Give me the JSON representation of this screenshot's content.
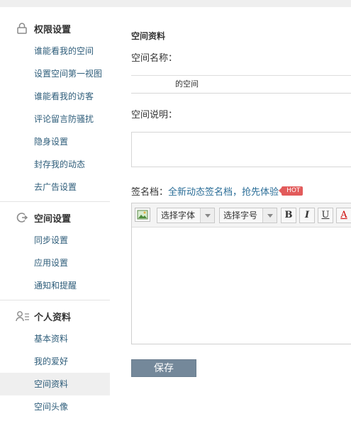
{
  "sidebar": {
    "sections": [
      {
        "title": "权限设置",
        "icon": "lock-icon",
        "items": [
          "谁能看我的空间",
          "设置空间第一视图",
          "谁能看我的访客",
          "评论留言防骚扰",
          "隐身设置",
          "封存我的动态",
          "去广告设置"
        ]
      },
      {
        "title": "空间设置",
        "icon": "space-settings-icon",
        "items": [
          "同步设置",
          "应用设置",
          "通知和提醒"
        ]
      },
      {
        "title": "个人资料",
        "icon": "profile-icon",
        "items": [
          "基本资料",
          "我的爱好",
          "空间资料",
          "空间头像"
        ]
      }
    ],
    "active_item": "空间资料"
  },
  "main": {
    "heading": "空间资料",
    "name_label": "空间名称：",
    "name_value": "的空间",
    "desc_label": "空间说明：",
    "sig_label": "签名档：",
    "sig_link": "全新动态签名档",
    "sig_sep": "，",
    "sig_try": "抢先体验",
    "hot_badge": "HOT",
    "toolbar": {
      "font_select": "选择字体",
      "size_select": "选择字号",
      "bold": "B",
      "italic": "I",
      "underline": "U",
      "color": "A"
    },
    "save_label": "保存"
  },
  "colors": {
    "link": "#2e5d7a",
    "active_bg": "#efefef",
    "save_button": "#74889a",
    "hot_badge": "#e25b5b"
  }
}
